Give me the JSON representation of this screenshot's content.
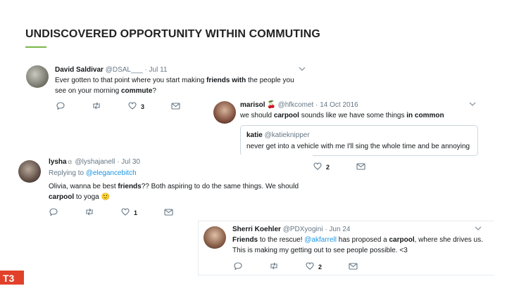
{
  "slide": {
    "title": "UNDISCOVERED OPPORTUNITY WITHIN COMMUTING",
    "logo": "T3"
  },
  "tweets": [
    {
      "name": "David Saldivar",
      "handle": "@DSAL___",
      "date": "· Jul 11",
      "text": [
        "Ever gotten to that point where you start making ",
        "friends with",
        " the people you",
        "see on your morning ",
        "commute",
        "?"
      ],
      "reply_count": "",
      "retweet_count": "",
      "like_count": "3"
    },
    {
      "name": "marisol 🍒",
      "handle": "@hfkcomet",
      "date": "· 14 Oct 2016",
      "text": [
        "we should ",
        "carpool",
        " sounds like we have some things ",
        "in common"
      ],
      "quote": {
        "name": "katie",
        "handle": "@katieknipper",
        "text": "never get into a vehicle with me I'll sing the whole time and be annoying"
      },
      "like_count": "2"
    },
    {
      "name": "lysha☼",
      "handle": "@lyshajanell",
      "date": "· Jul 30",
      "replying_prefix": "Replying to ",
      "replying_to": "@elegancebitch",
      "text": [
        "Olivia, wanna be best ",
        "friends",
        "?? Both aspiring to do the same things. We should",
        "carpool",
        " to yoga ",
        "🙂"
      ],
      "like_count": "1"
    },
    {
      "name": "Sherri Koehler",
      "handle": "@PDXyogini",
      "date": "· Jun 24",
      "text": [
        "Friends",
        " to the rescue! ",
        "@akfarrell",
        " has proposed a ",
        "carpool",
        ", where she drives us.",
        "This is making my getting out to see people possible. <3"
      ],
      "like_count": "2"
    }
  ],
  "icons": [
    "reply-icon",
    "retweet-icon",
    "like-icon",
    "message-icon",
    "chevron-down-icon"
  ]
}
